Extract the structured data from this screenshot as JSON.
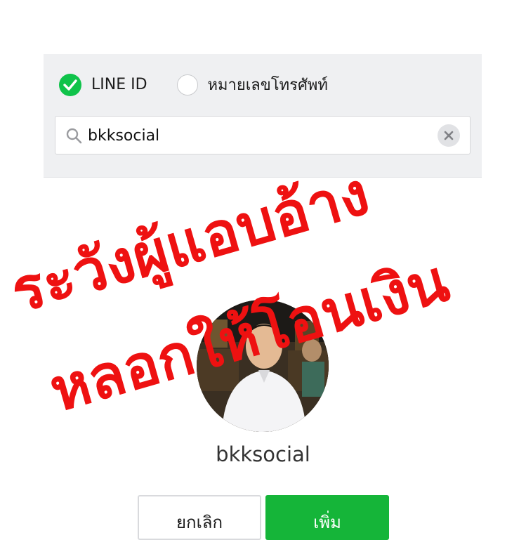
{
  "search_panel": {
    "option_line_id": "LINE ID",
    "option_phone": "หมายเลขโทรศัพท์",
    "query": "bkksocial"
  },
  "profile": {
    "name": "bkksocial"
  },
  "actions": {
    "cancel_label": "ยกเลิก",
    "add_label": "เพิ่ม"
  },
  "overlay": {
    "line1": "ระวังผู้แอบอ้าง",
    "line2": "หลอกให้โอนเงิน",
    "color": "#ee1111"
  },
  "colors": {
    "accent_green": "#0fc34a",
    "button_green": "#15b539",
    "panel_bg": "#eff0f2"
  },
  "icons": [
    "check-icon",
    "search-icon",
    "clear-icon"
  ]
}
